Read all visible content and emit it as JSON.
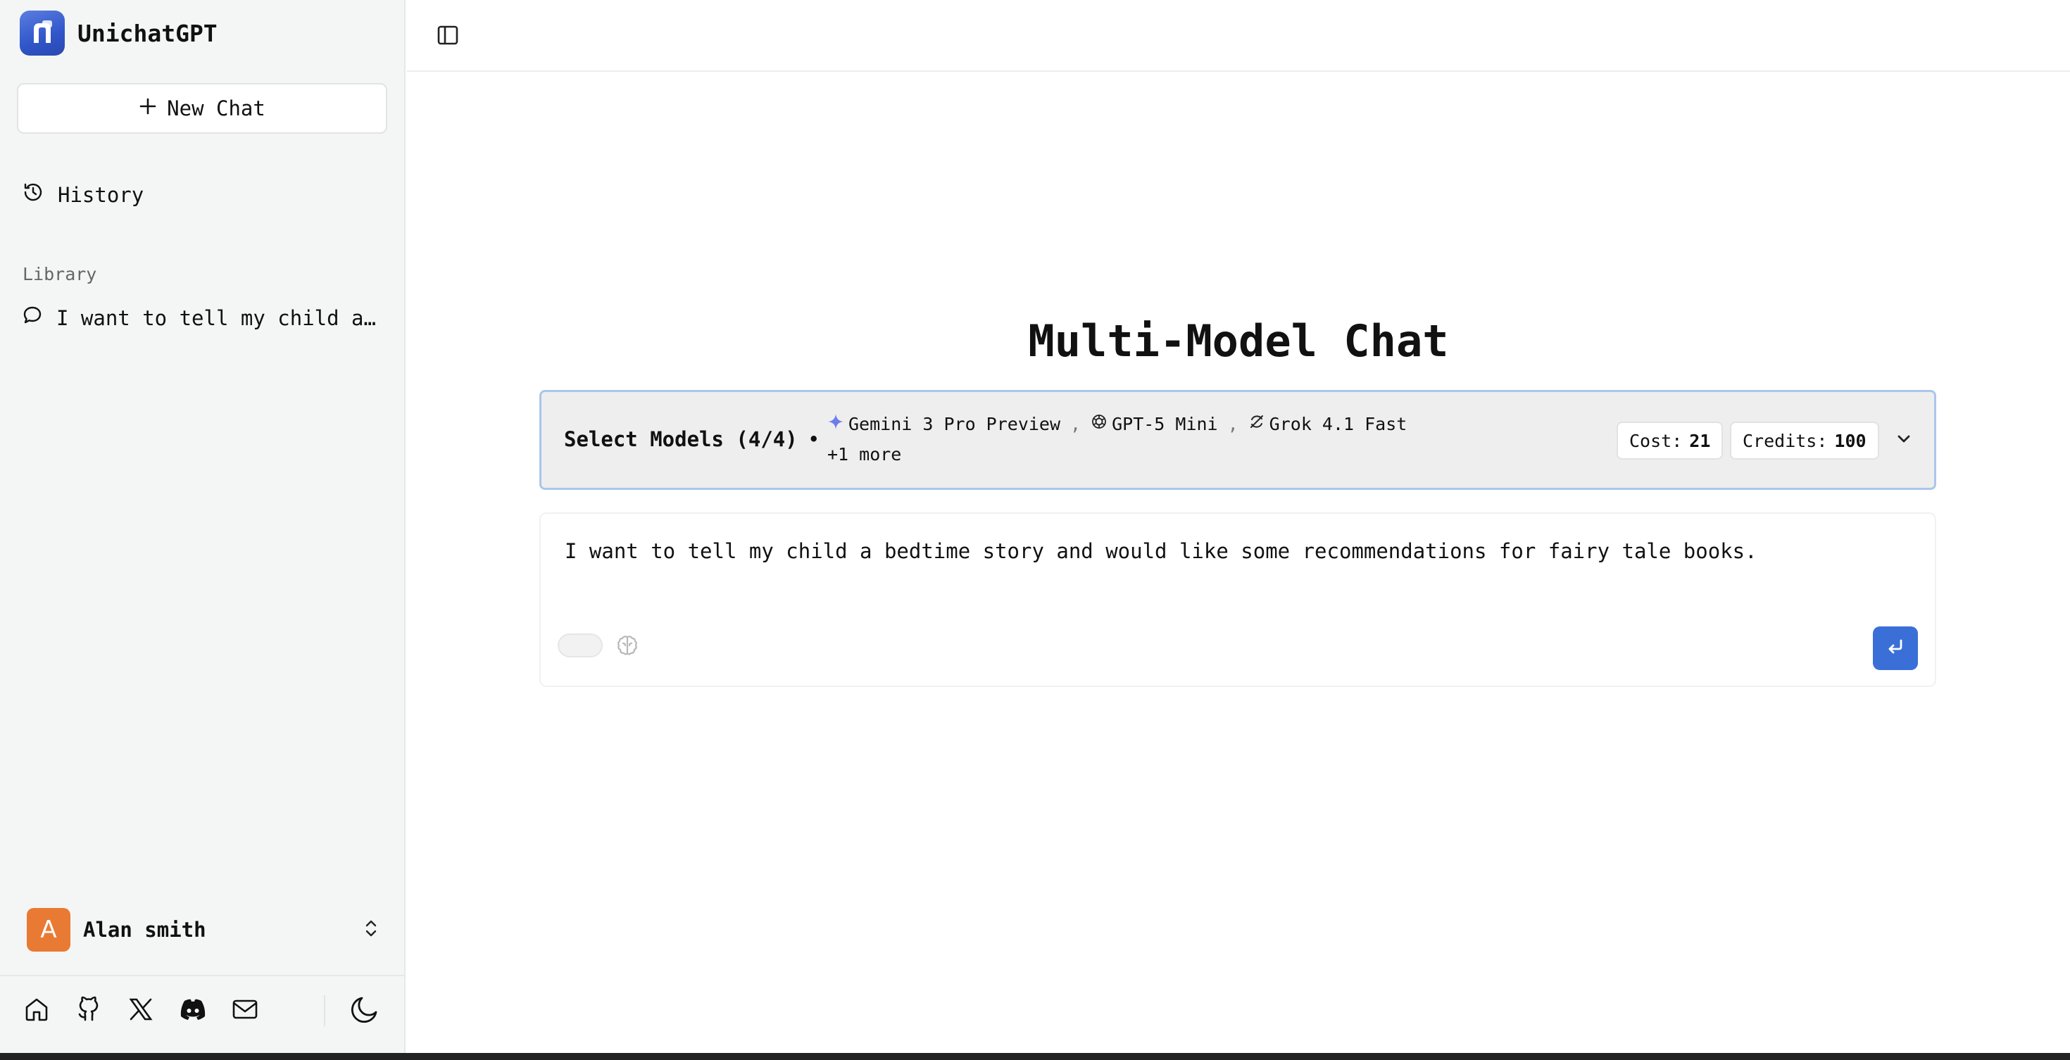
{
  "app": {
    "name": "UnichatGPT"
  },
  "sidebar": {
    "new_chat_label": "New Chat",
    "history_label": "History",
    "library_label": "Library",
    "library_items": [
      {
        "label": "I want to tell my child a …"
      }
    ],
    "user": {
      "initial": "A",
      "name": "Alan smith"
    },
    "social_icons": [
      "home-icon",
      "github-icon",
      "x-icon",
      "discord-icon",
      "mail-icon"
    ],
    "theme_icon": "moon-icon"
  },
  "main": {
    "title": "Multi-Model Chat",
    "models": {
      "label": "Select Models (4/4)",
      "separator": "•",
      "selected": [
        {
          "name": "Gemini 3 Pro Preview",
          "icon": "gemini-icon"
        },
        {
          "name": "GPT-5 Mini",
          "icon": "openai-icon"
        },
        {
          "name": "Grok 4.1 Fast",
          "icon": "grok-icon"
        }
      ],
      "more": "+1 more",
      "cost_label": "Cost:",
      "cost_value": "21",
      "credits_label": "Credits:",
      "credits_value": "100"
    },
    "prompt": {
      "value": "I want to tell my child a bedtime story and would like some recommendations for fairy tale books."
    }
  },
  "colors": {
    "accent": "#3b6fd8",
    "avatar": "#e97a34",
    "panel_border": "#a9c6ec"
  }
}
